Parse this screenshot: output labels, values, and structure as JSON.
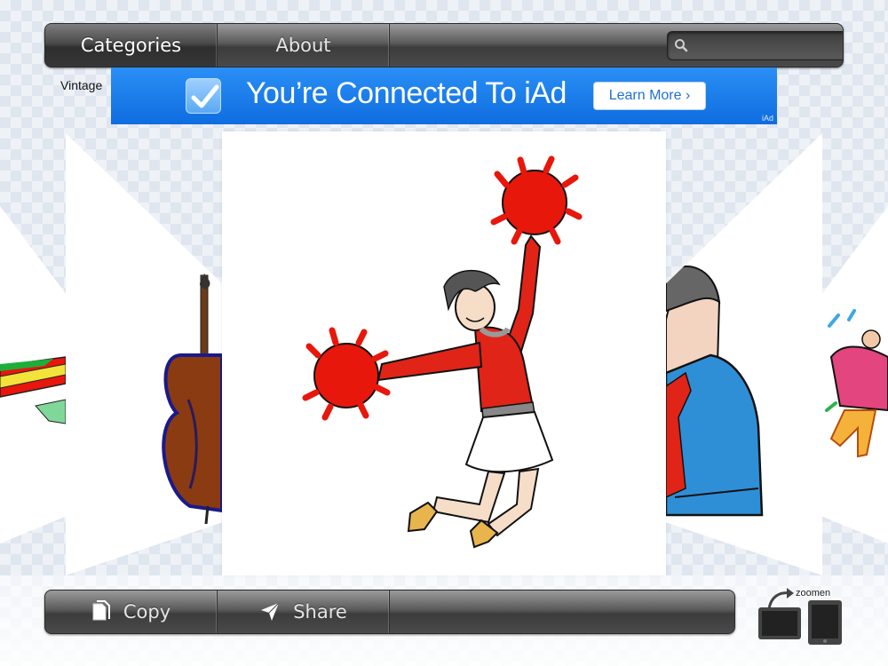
{
  "toolbar": {
    "tabs": [
      {
        "label": "Categories",
        "active": true
      },
      {
        "label": "About",
        "active": false
      }
    ],
    "search": {
      "placeholder": "",
      "value": ""
    }
  },
  "category": {
    "name": "Vintage"
  },
  "ad": {
    "headline": "You’re Connected To iAd",
    "button_label": "Learn More ›",
    "tag": "iAd",
    "color": "#1a7ee8"
  },
  "carousel": {
    "items": [
      {
        "icon": "ruler-clipart"
      },
      {
        "icon": "cello-clipart"
      },
      {
        "icon": "cheerleader-clipart"
      },
      {
        "icon": "businessman-clipart"
      },
      {
        "icon": "dancing-man-clipart"
      }
    ]
  },
  "bottom_toolbar": {
    "copy_label": "Copy",
    "share_label": "Share"
  },
  "zoom": {
    "label": "zoomen"
  },
  "colors": {
    "accent": "#1a7ee8",
    "pompom": "#e8170c",
    "shirt": "#e02418",
    "suit": "#2f8fd6"
  }
}
